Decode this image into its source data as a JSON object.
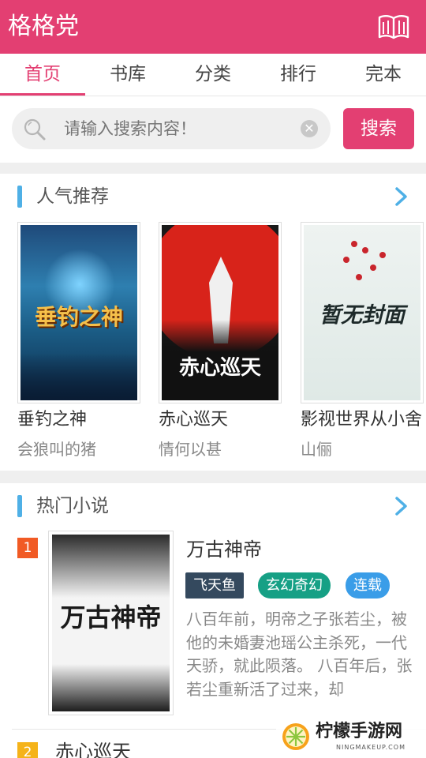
{
  "header": {
    "title": "格格党",
    "icon": "open-book-icon"
  },
  "tabs": [
    {
      "label": "首页",
      "active": true
    },
    {
      "label": "书库",
      "active": false
    },
    {
      "label": "分类",
      "active": false
    },
    {
      "label": "排行",
      "active": false
    },
    {
      "label": "完本",
      "active": false
    }
  ],
  "search": {
    "placeholder": "请输入搜索内容！",
    "button_label": "搜索"
  },
  "popular": {
    "title": "人气推荐",
    "books": [
      {
        "name": "垂钓之神",
        "author": "会狼叫的猪",
        "cover_text": "垂钓之神"
      },
      {
        "name": "赤心巡天",
        "author": "情何以甚",
        "cover_text": "赤心巡天"
      },
      {
        "name": "影视世界从小舍",
        "author": "山俪",
        "cover_text": "暂无封面"
      }
    ]
  },
  "hot": {
    "title": "热门小说",
    "items": [
      {
        "rank": "1",
        "rank_color": "#f15a24",
        "title": "万古神帝",
        "cover_text": "万古神帝",
        "tags": [
          {
            "label": "飞天鱼",
            "color": "#34495e"
          },
          {
            "label": "玄幻奇幻",
            "color": "#16a085"
          },
          {
            "label": "连载",
            "color": "#3a9de8"
          }
        ],
        "description": "八百年前，明帝之子张若尘，被他的未婚妻池瑶公主杀死，一代天骄，就此陨落。 八百年后，张若尘重新活了过来，却"
      },
      {
        "rank": "2",
        "rank_color": "#f5b319",
        "title": "赤心巡天"
      }
    ]
  },
  "watermark": {
    "text": "柠檬手游网",
    "sub": "NINGMAKEUP.COM"
  },
  "colors": {
    "brand": "#e33f72",
    "accent": "#4fb0e6"
  }
}
